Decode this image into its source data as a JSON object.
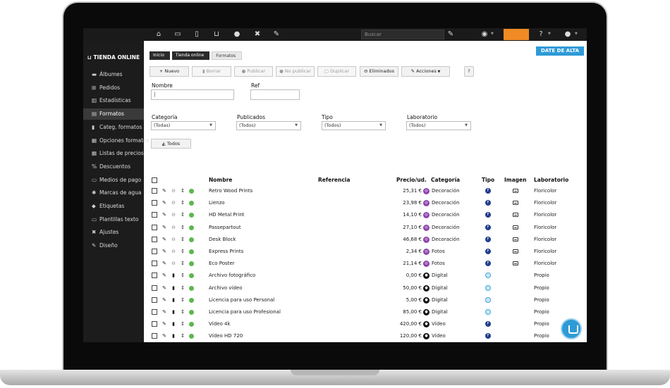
{
  "brand": "TIENDA ONLINE",
  "search_placeholder": "Buscar",
  "sidebar": {
    "items": [
      {
        "label": "Álbumes",
        "icon": "folder-icon",
        "glyph": "▬"
      },
      {
        "label": "Pedidos",
        "icon": "cart-icon",
        "glyph": "⊞"
      },
      {
        "label": "Estadísticas",
        "icon": "chart-icon",
        "glyph": "▥"
      },
      {
        "label": "Formatos",
        "icon": "formats-icon",
        "glyph": "▤"
      },
      {
        "label": "Categ. formatos",
        "icon": "bookmark-icon",
        "glyph": "▮"
      },
      {
        "label": "Opciones formatos",
        "icon": "options-icon",
        "glyph": "▦"
      },
      {
        "label": "Listas de precios",
        "icon": "table-icon",
        "glyph": "▦"
      },
      {
        "label": "Descuentos",
        "icon": "percent-icon",
        "glyph": "%"
      },
      {
        "label": "Medios de pago",
        "icon": "card-icon",
        "glyph": "▭"
      },
      {
        "label": "Marcas de agua",
        "icon": "watermark-icon",
        "glyph": "✺"
      },
      {
        "label": "Etiquetas",
        "icon": "tag-icon",
        "glyph": "◆"
      },
      {
        "label": "Plantillas texto",
        "icon": "template-icon",
        "glyph": "▭"
      },
      {
        "label": "Ajustes",
        "icon": "tools-icon",
        "glyph": "✖"
      },
      {
        "label": "Diseño",
        "icon": "brush-icon",
        "glyph": "✎"
      }
    ],
    "active_index": 3
  },
  "breadcrumb": [
    "Inicio",
    "Tienda online",
    "Formatos"
  ],
  "date_button": "DATE DE ALTA",
  "toolbar": {
    "nuevo": "+ Nuevo",
    "borrar": "Borrar",
    "publicar": "Publicar",
    "no_publicar": "No publicar",
    "duplicar": "Duplicar",
    "eliminados": "Eliminados",
    "acciones": "Acciones",
    "help": "?"
  },
  "filters": {
    "nombre_label": "Nombre",
    "nombre_value": "|",
    "ref_label": "Ref",
    "ref_value": "",
    "categoria_label": "Categoría",
    "categoria_value": "(Todas)",
    "publicados_label": "Publicados",
    "publicados_value": "(Todos)",
    "tipo_label": "Tipo",
    "tipo_value": "(Todos)",
    "laboratorio_label": "Laboratorio",
    "laboratorio_value": "(Todos)",
    "todos_button": "Todos"
  },
  "table": {
    "headers": {
      "nombre": "Nombre",
      "referencia": "Referencia",
      "precio": "Precio/ud.",
      "categoria": "Categoría",
      "tipo": "Tipo",
      "imagen": "Imagen",
      "laboratorio": "Laboratorio"
    },
    "rows": [
      {
        "nombre": "Retro Wood Prints",
        "precio": "25,31 €",
        "categoria": "Decoración",
        "cat_color": "#8e44ad",
        "tipo": "F",
        "imagen": true,
        "laboratorio": "Floricolor",
        "action": "minus"
      },
      {
        "nombre": "Lienzo",
        "precio": "23,98 €",
        "categoria": "Decoración",
        "cat_color": "#8e44ad",
        "tipo": "F",
        "imagen": true,
        "laboratorio": "Floricolor",
        "action": "minus"
      },
      {
        "nombre": "HD Metal Print",
        "precio": "14,10 €",
        "categoria": "Decoración",
        "cat_color": "#8e44ad",
        "tipo": "F",
        "imagen": true,
        "laboratorio": "Floricolor",
        "action": "minus"
      },
      {
        "nombre": "Passepartout",
        "precio": "27,10 €",
        "categoria": "Decoración",
        "cat_color": "#8e44ad",
        "tipo": "F",
        "imagen": true,
        "laboratorio": "Floricolor",
        "action": "minus"
      },
      {
        "nombre": "Desk Block",
        "precio": "46,68 €",
        "categoria": "Decoración",
        "cat_color": "#8e44ad",
        "tipo": "F",
        "imagen": true,
        "laboratorio": "Floricolor",
        "action": "minus"
      },
      {
        "nombre": "Express Prints",
        "precio": "2,34 €",
        "categoria": "Fotos",
        "cat_color": "#8e44ad",
        "tipo": "F",
        "imagen": true,
        "laboratorio": "Floricolor",
        "action": "minus"
      },
      {
        "nombre": "Eco Poster",
        "precio": "21,14 €",
        "categoria": "Fotos",
        "cat_color": "#8e44ad",
        "tipo": "F",
        "imagen": true,
        "laboratorio": "Floricolor",
        "action": "minus"
      },
      {
        "nombre": "Archivo fotográfico",
        "precio": "0,00 €",
        "categoria": "Digital",
        "cat_color": "#111111",
        "tipo": "D",
        "imagen": false,
        "laboratorio": "Propio",
        "action": "trash"
      },
      {
        "nombre": "Archivo vídeo",
        "precio": "50,00 €",
        "categoria": "Digital",
        "cat_color": "#111111",
        "tipo": "D",
        "imagen": false,
        "laboratorio": "Propio",
        "action": "trash"
      },
      {
        "nombre": "Licencia para uso Personal",
        "precio": "5,00 €",
        "categoria": "Digital",
        "cat_color": "#111111",
        "tipo": "D",
        "imagen": false,
        "laboratorio": "Propio",
        "action": "trash"
      },
      {
        "nombre": "Licencia para uso Profesional",
        "precio": "85,00 €",
        "categoria": "Digital",
        "cat_color": "#111111",
        "tipo": "D",
        "imagen": false,
        "laboratorio": "Propio",
        "action": "trash"
      },
      {
        "nombre": "Vídeo 4k",
        "precio": "420,00 €",
        "categoria": "Vídeo",
        "cat_color": "#111111",
        "tipo": "F",
        "imagen": false,
        "laboratorio": "Propio",
        "action": "trash"
      },
      {
        "nombre": "Vídeo HD 720",
        "precio": "120,00 €",
        "categoria": "Vídeo",
        "cat_color": "#111111",
        "tipo": "F",
        "imagen": false,
        "laboratorio": "Propio",
        "action": "trash"
      }
    ]
  },
  "colors": {
    "accent_blue": "#2e9bd6",
    "orange": "#f08a24",
    "status_green": "#5cb84c",
    "tipo_f": "#1f3d8a"
  }
}
